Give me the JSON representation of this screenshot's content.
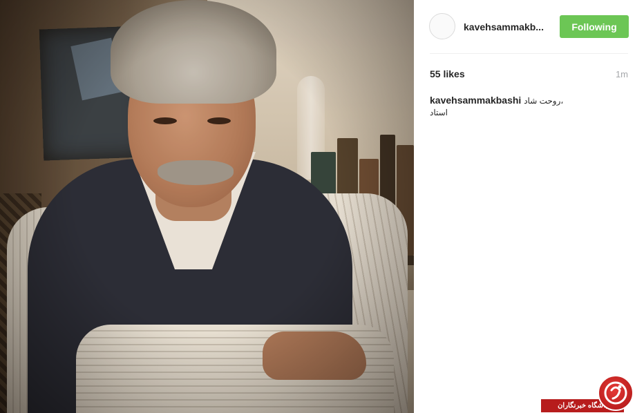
{
  "post": {
    "photo_alt": "Portrait of an elderly man with grey hair and moustache wearing a dark vest"
  },
  "header": {
    "username": "kavehsammakb...",
    "follow_label": "Following",
    "follow_color": "#6cc655"
  },
  "stats": {
    "likes": "55 likes",
    "time": "1m"
  },
  "caption": {
    "username": "kavehsammakbashi",
    "text_line1": "روحت شاد،",
    "text_line2": "استاد"
  },
  "watermark": {
    "label": "باشگاه خبرنگاران",
    "logo_icon": "brand-logo-icon",
    "color": "#b71c1c"
  }
}
